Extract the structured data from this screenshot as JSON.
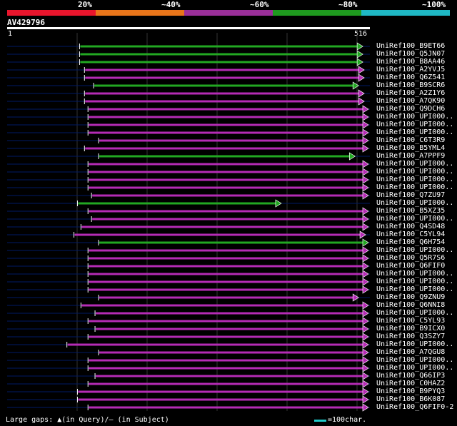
{
  "identity_legend": {
    "segments": [
      {
        "label": "20%",
        "color": "#e8152c"
      },
      {
        "label": "~40%",
        "color": "#e8751a"
      },
      {
        "label": "~60%",
        "color": "#9a2f99"
      },
      {
        "label": "~80%",
        "color": "#1f9a1f"
      },
      {
        "label": "~100%",
        "color": "#1fb8c4"
      }
    ]
  },
  "query": {
    "name": "AV429796",
    "start": "1",
    "end": "516",
    "length": 516
  },
  "colors": {
    "magenta": "#b52bb5",
    "green": "#22a822",
    "track": "#001a66",
    "gap_marker": "#ffffaa"
  },
  "hits": [
    {
      "label": "UniRef100_B9ET66",
      "color": "green",
      "start": 103,
      "end": 506
    },
    {
      "label": "UniRef100_Q5JN07",
      "color": "green",
      "start": 103,
      "end": 506
    },
    {
      "label": "UniRef100_B8AA46",
      "color": "green",
      "start": 103,
      "end": 506
    },
    {
      "label": "UniRef100_A2YVJ5",
      "color": "magenta",
      "start": 110,
      "end": 508
    },
    {
      "label": "UniRef100_Q6Z541",
      "color": "magenta",
      "start": 110,
      "end": 508
    },
    {
      "label": "UniRef100_B9SCR6",
      "color": "green",
      "start": 123,
      "end": 500
    },
    {
      "label": "UniRef100_A2Z1Y6",
      "color": "magenta",
      "start": 110,
      "end": 508
    },
    {
      "label": "UniRef100_A7QK90",
      "color": "magenta",
      "start": 110,
      "end": 508
    },
    {
      "label": "UniRef100_Q9DCH6",
      "color": "magenta",
      "start": 115,
      "end": 540
    },
    {
      "label": "UniRef100_UPI000..",
      "color": "magenta",
      "start": 115,
      "end": 560
    },
    {
      "label": "UniRef100_UPI000..",
      "color": "magenta",
      "start": 115,
      "end": 560
    },
    {
      "label": "UniRef100_UPI000..",
      "color": "magenta",
      "start": 115,
      "end": 535
    },
    {
      "label": "UniRef100_C6T3R9",
      "color": "magenta",
      "start": 130,
      "end": 540
    },
    {
      "label": "UniRef100_B5YML4",
      "color": "magenta",
      "start": 110,
      "end": 540
    },
    {
      "label": "UniRef100_A7PPF9",
      "color": "green",
      "start": 130,
      "end": 495
    },
    {
      "label": "UniRef100_UPI000..",
      "color": "magenta",
      "start": 115,
      "end": 555
    },
    {
      "label": "UniRef100_UPI000..",
      "color": "magenta",
      "start": 115,
      "end": 555
    },
    {
      "label": "UniRef100_UPI000..",
      "color": "magenta",
      "start": 115,
      "end": 555
    },
    {
      "label": "UniRef100_UPI000..",
      "color": "magenta",
      "start": 115,
      "end": 555
    },
    {
      "label": "UniRef100_Q7ZU97",
      "color": "magenta",
      "start": 120,
      "end": 555
    },
    {
      "label": "UniRef100_UPI000..",
      "color": "green",
      "start": 100,
      "end": 390
    },
    {
      "label": "UniRef100_B5XZ35",
      "color": "magenta",
      "start": 115,
      "end": 535
    },
    {
      "label": "UniRef100_UPI000..",
      "color": "magenta",
      "start": 120,
      "end": 540
    },
    {
      "label": "UniRef100_Q4SD48",
      "color": "magenta",
      "start": 105,
      "end": 540
    },
    {
      "label": "UniRef100_C5YL94",
      "color": "magenta",
      "start": 95,
      "end": 510
    },
    {
      "label": "UniRef100_Q6H754",
      "color": "green",
      "start": 130,
      "end": 540
    },
    {
      "label": "UniRef100_UPI000..",
      "color": "magenta",
      "start": 115,
      "end": 565
    },
    {
      "label": "UniRef100_Q5R7S6",
      "color": "magenta",
      "start": 115,
      "end": 540
    },
    {
      "label": "UniRef100_Q6FIF0",
      "color": "magenta",
      "start": 115,
      "end": 540
    },
    {
      "label": "UniRef100_UPI000..",
      "color": "magenta",
      "start": 115,
      "end": 540
    },
    {
      "label": "UniRef100_UPI000..",
      "color": "magenta",
      "start": 115,
      "end": 555
    },
    {
      "label": "UniRef100_UPI000..",
      "color": "magenta",
      "start": 115,
      "end": 555
    },
    {
      "label": "UniRef100_Q9ZNU9",
      "color": "magenta",
      "start": 130,
      "end": 500
    },
    {
      "label": "UniRef100_Q6NNI8",
      "color": "magenta",
      "start": 105,
      "end": 555
    },
    {
      "label": "UniRef100_UPI000..",
      "color": "magenta",
      "start": 125,
      "end": 535
    },
    {
      "label": "UniRef100_C5YL93",
      "color": "magenta",
      "start": 115,
      "end": 540
    },
    {
      "label": "UniRef100_B9ICX0",
      "color": "magenta",
      "start": 125,
      "end": 525
    },
    {
      "label": "UniRef100_Q3SZY7",
      "color": "magenta",
      "start": 115,
      "end": 540
    },
    {
      "label": "UniRef100_UPI000..",
      "color": "magenta",
      "start": 85,
      "end": 555
    },
    {
      "label": "UniRef100_A7QGU8",
      "color": "magenta",
      "start": 130,
      "end": 525
    },
    {
      "label": "UniRef100_UPI000..",
      "color": "magenta",
      "start": 115,
      "end": 555
    },
    {
      "label": "UniRef100_UPI000..",
      "color": "magenta",
      "start": 115,
      "end": 555
    },
    {
      "label": "UniRef100_Q66IP3",
      "color": "magenta",
      "start": 125,
      "end": 555
    },
    {
      "label": "UniRef100_C0HAZ2",
      "color": "magenta",
      "start": 115,
      "end": 535
    },
    {
      "label": "UniRef100_B9PYQ3",
      "color": "magenta",
      "start": 100,
      "end": 555
    },
    {
      "label": "UniRef100_B6K087",
      "color": "magenta",
      "start": 100,
      "end": 555
    },
    {
      "label": "UniRef100_Q6FIF0-2",
      "color": "magenta",
      "start": 115,
      "end": 535
    }
  ],
  "footer": {
    "gaps_text": "Large gaps: ▲(in Query)/– (in Subject)",
    "scale_text": "=100char."
  }
}
